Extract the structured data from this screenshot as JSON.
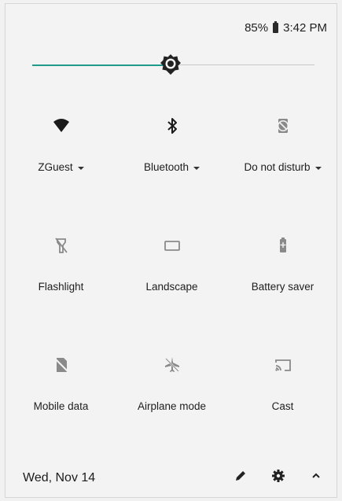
{
  "status_bar": {
    "battery": "85%",
    "time": "3:42 PM"
  },
  "brightness": {
    "level": 0.49
  },
  "tiles": [
    {
      "label": "ZGuest",
      "icon": "wifi-icon",
      "dropdown": true,
      "active": true
    },
    {
      "label": "Bluetooth",
      "icon": "bluetooth-icon",
      "dropdown": true,
      "active": true
    },
    {
      "label": "Do not disturb",
      "icon": "do-not-disturb-icon",
      "dropdown": true,
      "active": false
    },
    {
      "label": "Flashlight",
      "icon": "flashlight-off-icon",
      "dropdown": false,
      "active": false
    },
    {
      "label": "Landscape",
      "icon": "landscape-icon",
      "dropdown": false,
      "active": false
    },
    {
      "label": "Battery saver",
      "icon": "battery-saver-icon",
      "dropdown": false,
      "active": false
    },
    {
      "label": "Mobile data",
      "icon": "mobile-data-off-icon",
      "dropdown": false,
      "active": false
    },
    {
      "label": "Airplane mode",
      "icon": "airplane-mode-icon",
      "dropdown": false,
      "active": false
    },
    {
      "label": "Cast",
      "icon": "cast-icon",
      "dropdown": false,
      "active": false
    }
  ],
  "footer": {
    "date": "Wed, Nov 14"
  },
  "colors": {
    "accent": "#1f9b8c",
    "inactive_icon": "#8a8a8a",
    "active_icon": "#1a1a1a"
  }
}
